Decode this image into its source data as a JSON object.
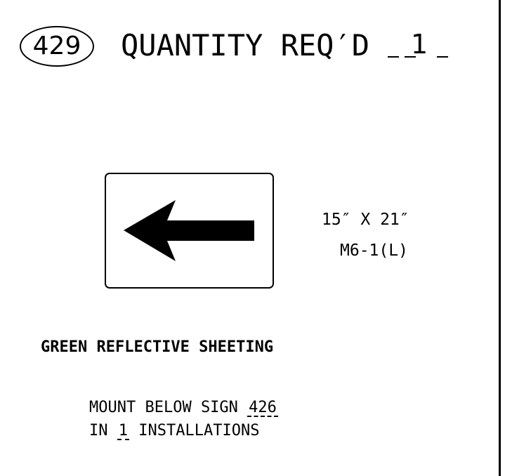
{
  "header": {
    "sign_number": "429",
    "quantity_label": "QUANTITY REQ′D",
    "quantity_value": "1"
  },
  "sign": {
    "icon": "left-arrow-icon",
    "size": "15″ X 21″",
    "code": "M6-1(L)"
  },
  "notes": {
    "sheeting": "GREEN REFLECTIVE SHEETING",
    "mount_prefix": "MOUNT BELOW SIGN",
    "mount_sign": "426",
    "install_prefix": "IN",
    "install_count": "1",
    "install_suffix": "INSTALLATIONS"
  }
}
